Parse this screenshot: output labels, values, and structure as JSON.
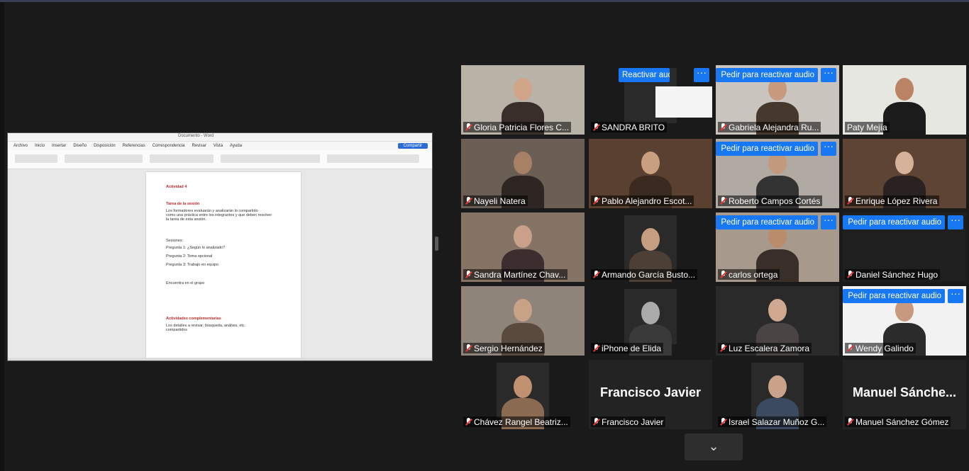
{
  "shared_document": {
    "window_title": "Documento - Word",
    "tabs": [
      "Archivo",
      "Inicio",
      "Insertar",
      "Diseño",
      "Disposición",
      "Referencias",
      "Correspondencia",
      "Revisar",
      "Vista",
      "Ayuda"
    ],
    "share_button": "Compartir",
    "lines": [
      {
        "text": "Actividad 4",
        "style": "red"
      },
      {
        "text": "Tarea de la sesión",
        "style": "red"
      },
      {
        "text": "Los formadores evaluarán y analizarán lo compartido",
        "style": "normal"
      },
      {
        "text": "como una práctica entre los integrantes y que deben resolver",
        "style": "normal"
      },
      {
        "text": "la tarea de esta sesión.",
        "style": "normal"
      },
      {
        "text": "Sesiones:",
        "style": "normal"
      },
      {
        "text": "Pregunta 1: ¿Según lo analizado?",
        "style": "normal"
      },
      {
        "text": "Pregunta 2: Tema opcional",
        "style": "normal"
      },
      {
        "text": "Pregunta 3: Trabajo en equipo",
        "style": "normal"
      },
      {
        "text": "Encuentra en el grupo",
        "style": "normal"
      },
      {
        "text": "Actividades complementarias",
        "style": "red"
      },
      {
        "text": "Los detalles a revisar, búsqueda, análisis, etc.",
        "style": "normal"
      },
      {
        "text": "compartidos",
        "style": "normal"
      }
    ]
  },
  "gallery": {
    "unmute_label_full": "Reactivar audio",
    "unmute_label_ask": "Pedir para reactivar audio",
    "more_label": "···",
    "participants": [
      {
        "name": "Gloria Patricia Flores C...",
        "muted": true,
        "unmute": false
      },
      {
        "name": "SANDRA BRITO",
        "muted": true,
        "unmute": "full"
      },
      {
        "name": "Gabriela Alejandra Ru...",
        "muted": true,
        "unmute": "ask"
      },
      {
        "name": "Paty Mejía",
        "muted": false,
        "unmute": false,
        "active": true
      },
      {
        "name": "Nayeli Natera",
        "muted": true,
        "unmute": false
      },
      {
        "name": "Pablo Alejandro Escot...",
        "muted": true,
        "unmute": false
      },
      {
        "name": "Roberto Campos Cortés",
        "muted": true,
        "unmute": "ask"
      },
      {
        "name": "Enrique López Rivera",
        "muted": true,
        "unmute": false
      },
      {
        "name": "Sandra Martínez Chav...",
        "muted": true,
        "unmute": false
      },
      {
        "name": "Armando García Busto...",
        "muted": true,
        "unmute": false
      },
      {
        "name": "carlos ortega",
        "muted": true,
        "unmute": "ask"
      },
      {
        "name": "Daniel Sánchez Hugo",
        "muted": true,
        "unmute": "ask"
      },
      {
        "name": "Sergio Hernández",
        "muted": true,
        "unmute": false
      },
      {
        "name": "iPhone de Elida",
        "muted": true,
        "unmute": false
      },
      {
        "name": "Luz Escalera Zamora",
        "muted": true,
        "unmute": false
      },
      {
        "name": "Wendy Galindo",
        "muted": true,
        "unmute": "ask"
      },
      {
        "name": "Chávez Rangel Beatriz...",
        "muted": true,
        "unmute": false
      },
      {
        "name": "Francisco Javier",
        "muted": true,
        "unmute": false,
        "video_off": true,
        "display": "Francisco Javier"
      },
      {
        "name": "Israel Salazar Muñoz G...",
        "muted": true,
        "unmute": false
      },
      {
        "name": "Manuel Sánchez Gómez",
        "muted": true,
        "unmute": false,
        "video_off": true,
        "display": "Manuel  Sánche..."
      }
    ]
  },
  "next_page_icon": "chevron-down-icon",
  "colors": {
    "accent": "#1877f2",
    "active_speaker": "#c3dd55",
    "muted": "#e53935"
  }
}
